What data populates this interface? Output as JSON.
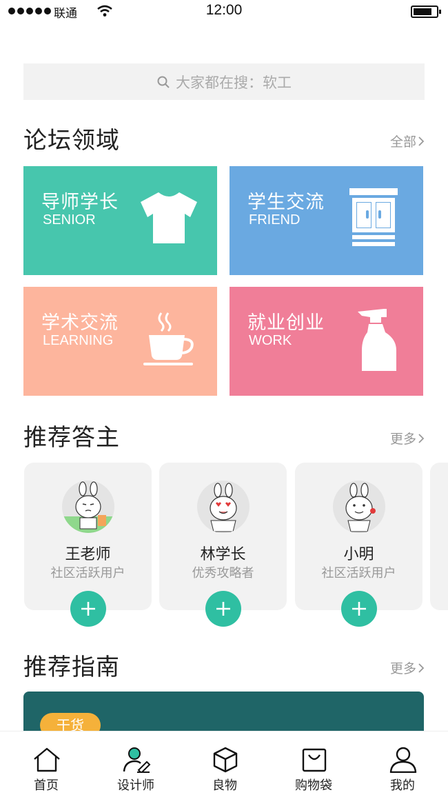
{
  "status_bar": {
    "carrier": "联通",
    "time": "12:00"
  },
  "search": {
    "placeholder": "大家都在搜：软工"
  },
  "forum": {
    "title": "论坛领域",
    "more": "全部",
    "categories": [
      {
        "cn": "导师学长",
        "en": "SENIOR",
        "color": "#47c6ad",
        "icon": "tshirt-icon"
      },
      {
        "cn": "学生交流",
        "en": "FRIEND",
        "color": "#6aa9e1",
        "icon": "cabinet-icon"
      },
      {
        "cn": "学术交流",
        "en": "LEARNING",
        "color": "#fdb59d",
        "icon": "coffee-cup-icon"
      },
      {
        "cn": "就业创业",
        "en": "WORK",
        "color": "#f07e98",
        "icon": "spray-bottle-icon"
      }
    ]
  },
  "answerers": {
    "title": "推荐答主",
    "more": "更多",
    "people": [
      {
        "name": "王老师",
        "role": "社区活跃用户"
      },
      {
        "name": "林学长",
        "role": "优秀攻略者"
      },
      {
        "name": "小明",
        "role": "社区活跃用户"
      }
    ]
  },
  "guides": {
    "title": "推荐指南",
    "more": "更多",
    "card": {
      "tag": "干货",
      "color": "#1f6567",
      "tag_color": "#f5b13a"
    }
  },
  "tabbar": {
    "items": [
      {
        "label": "首页",
        "icon": "home-icon"
      },
      {
        "label": "设计师",
        "icon": "designer-icon"
      },
      {
        "label": "良物",
        "icon": "box-icon"
      },
      {
        "label": "购物袋",
        "icon": "shopping-bag-icon"
      },
      {
        "label": "我的",
        "icon": "profile-icon"
      }
    ]
  },
  "colors": {
    "accent": "#2fbfa2"
  }
}
